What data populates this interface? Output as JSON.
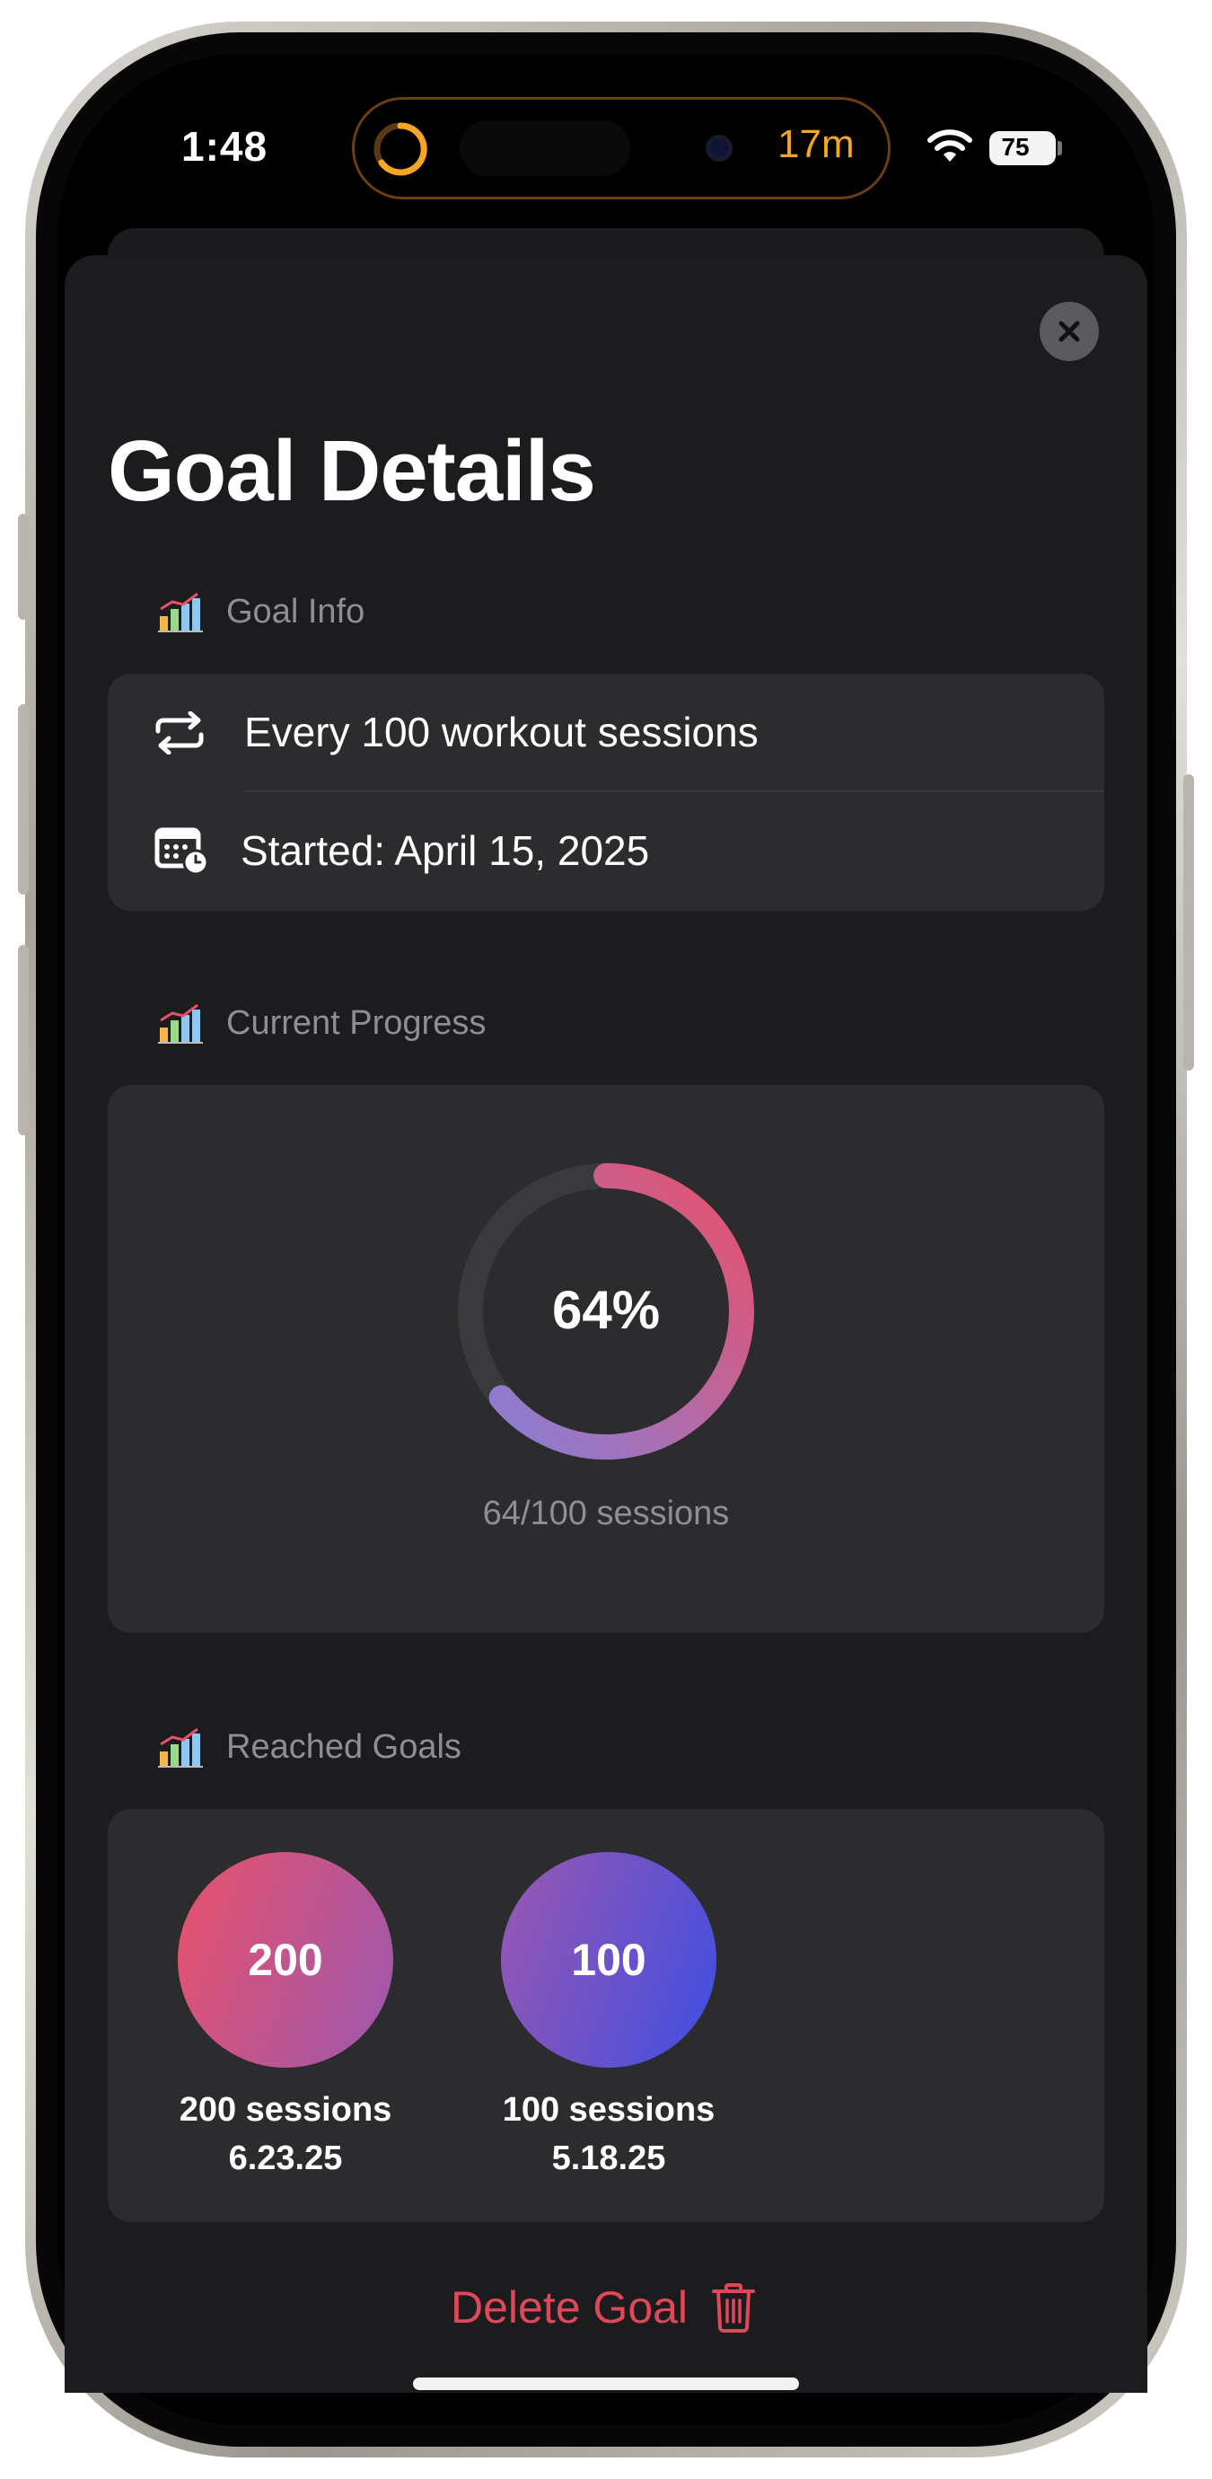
{
  "status_bar": {
    "time": "1:48",
    "island_timer": "17m",
    "battery": "75"
  },
  "sheet": {
    "title": "Goal Details",
    "close_icon": "xmark-icon"
  },
  "goal_info": {
    "header": "Goal Info",
    "header_icon": "chart-bar-icon",
    "frequency_icon": "repeat-icon",
    "frequency_text": "Every 100 workout sessions",
    "start_icon": "calendar-clock-icon",
    "start_text": "Started: April 15, 2025"
  },
  "progress": {
    "header": "Current Progress",
    "header_icon": "chart-bar-icon",
    "percent_label": "64%",
    "fraction": 0.64,
    "sessions_text": "64/100 sessions",
    "gradient_start": "#e8506a",
    "gradient_end": "#8a7fd6"
  },
  "reached_goals": {
    "header": "Reached Goals",
    "header_icon": "chart-bar-icon",
    "items": [
      {
        "badge": "200",
        "label": "200 sessions",
        "date": "6.23.25",
        "color_start": "#e9526a",
        "color_end": "#9b58b0"
      },
      {
        "badge": "100",
        "label": "100 sessions",
        "date": "5.18.25",
        "color_start": "#9b58b0",
        "color_end": "#3e4ee2"
      }
    ]
  },
  "actions": {
    "delete_label": "Delete Goal",
    "delete_icon": "trash-icon",
    "delete_color": "#e0485a"
  }
}
